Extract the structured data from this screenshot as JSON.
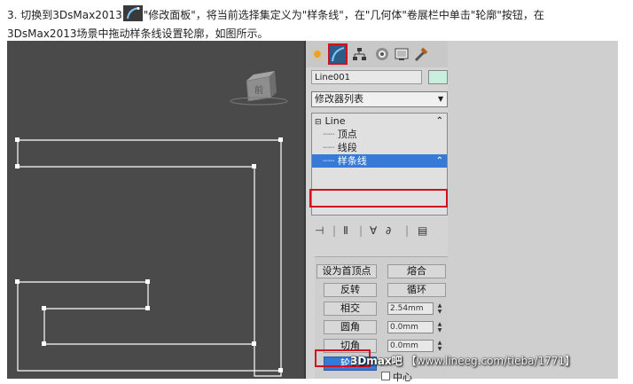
{
  "instructions": {
    "part1": "3. 切换到3DsMax2013",
    "part2": "\"修改面板\"，将当前选择集定义为\"样条线\"，在\"几何体\"卷展栏中单击\"轮廓\"按钮，在",
    "line2": "3DsMax2013场景中拖动样条线设置轮廓，如图所示。"
  },
  "viewport": {
    "viewcube_label": "前"
  },
  "modify_panel": {
    "object_name": "Line001",
    "modifier_list": "修改器列表",
    "stack": [
      "Line",
      "顶点",
      "线段",
      "样条线"
    ],
    "selected_stack_item": "样条线"
  },
  "geometry_rollout": {
    "buttons": [
      {
        "label": "设为首顶点"
      },
      {
        "label": "熔合"
      },
      {
        "label": "反转"
      },
      {
        "label": "循环"
      },
      {
        "label": "相交"
      },
      {
        "label": "圆角"
      },
      {
        "label": "切角"
      },
      {
        "label": "轮廓"
      }
    ],
    "spinners": [
      "2.54mm",
      "0.0mm",
      "0.0mm"
    ],
    "checkbox_label": "中心"
  },
  "watermark": {
    "brand": "3Dmax吧",
    "url": "【www.lineeg.com/tieba/1771】"
  },
  "colors": {
    "highlight_red": "#d0101e",
    "selection_blue": "#3779d6",
    "viewport_bg": "#4a4a4a"
  }
}
